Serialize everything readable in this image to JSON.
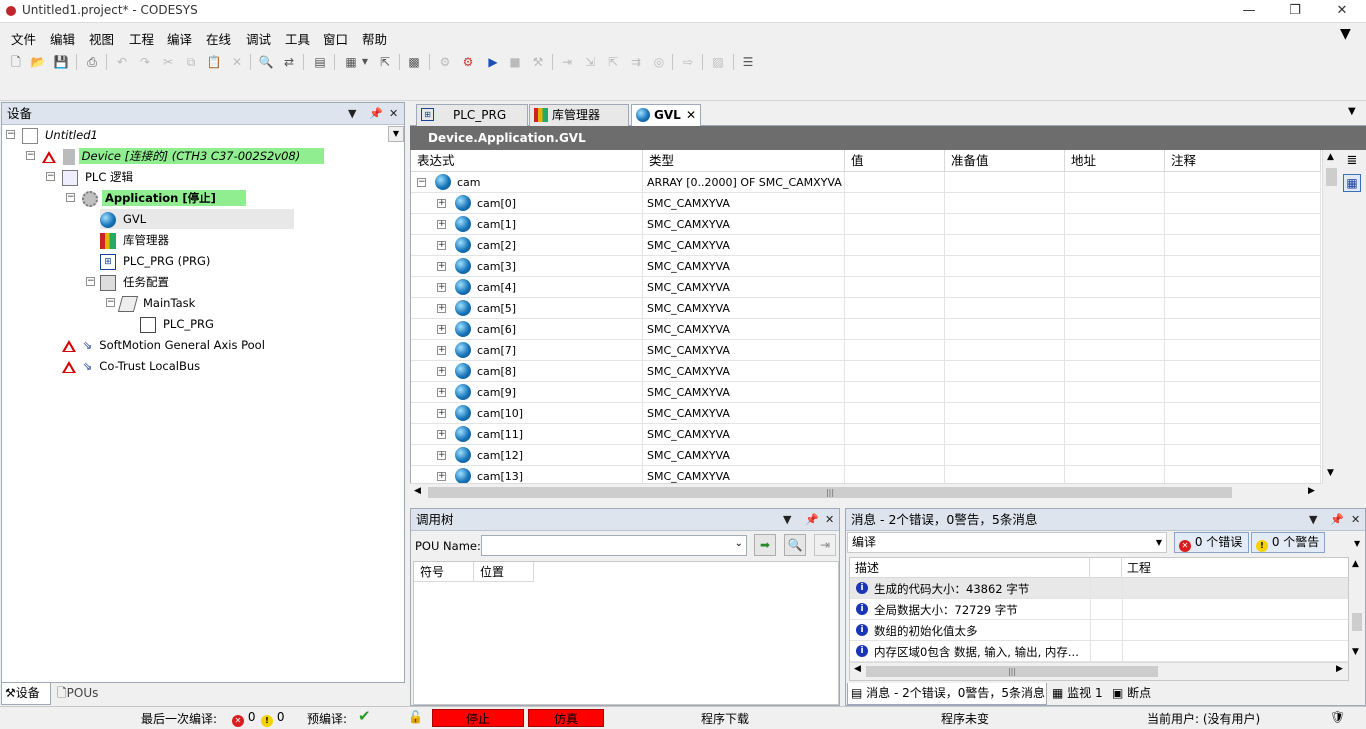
{
  "window": {
    "title": "Untitled1.project* - CODESYS",
    "minimize": "—",
    "restore": "❐",
    "close": "✕"
  },
  "menu": [
    "文件",
    "编辑",
    "视图",
    "工程",
    "编译",
    "在线",
    "调试",
    "工具",
    "窗口",
    "帮助"
  ],
  "device_panel": {
    "title": "设备",
    "tree": {
      "root": "Untitled1",
      "device": "Device [连接的] (CTH3 C37-002S2v08)",
      "plc_logic": "PLC 逻辑",
      "application": "Application [停止]",
      "gvl": "GVL",
      "library_manager": "库管理器",
      "plc_prg": "PLC_PRG (PRG)",
      "task_config": "任务配置",
      "main_task": "MainTask",
      "main_task_prg": "PLC_PRG",
      "softmotion": "SoftMotion General Axis Pool",
      "localbus": "Co-Trust LocalBus"
    },
    "tabs": [
      "设备",
      "POUs"
    ]
  },
  "editor": {
    "tabs": [
      "PLC_PRG",
      "库管理器",
      "GVL"
    ],
    "header": "Device.Application.GVL",
    "columns": [
      "表达式",
      "类型",
      "值",
      "准备值",
      "地址",
      "注释"
    ],
    "rows": [
      {
        "expr": "cam",
        "type": "ARRAY [0..2000] OF SMC_CAMXYVA"
      },
      {
        "expr": "cam[0]",
        "type": "SMC_CAMXYVA"
      },
      {
        "expr": "cam[1]",
        "type": "SMC_CAMXYVA"
      },
      {
        "expr": "cam[2]",
        "type": "SMC_CAMXYVA"
      },
      {
        "expr": "cam[3]",
        "type": "SMC_CAMXYVA"
      },
      {
        "expr": "cam[4]",
        "type": "SMC_CAMXYVA"
      },
      {
        "expr": "cam[5]",
        "type": "SMC_CAMXYVA"
      },
      {
        "expr": "cam[6]",
        "type": "SMC_CAMXYVA"
      },
      {
        "expr": "cam[7]",
        "type": "SMC_CAMXYVA"
      },
      {
        "expr": "cam[8]",
        "type": "SMC_CAMXYVA"
      },
      {
        "expr": "cam[9]",
        "type": "SMC_CAMXYVA"
      },
      {
        "expr": "cam[10]",
        "type": "SMC_CAMXYVA"
      },
      {
        "expr": "cam[11]",
        "type": "SMC_CAMXYVA"
      },
      {
        "expr": "cam[12]",
        "type": "SMC_CAMXYVA"
      },
      {
        "expr": "cam[13]",
        "type": "SMC_CAMXYVA"
      }
    ]
  },
  "call_tree": {
    "title": "调用树",
    "pou_label": "POU Name:",
    "pou_value": "",
    "columns": [
      "符号",
      "位置"
    ]
  },
  "messages": {
    "title": "消息 - 2个错误，0警告，5条消息",
    "category": "编译",
    "errors_btn": "0 个错误",
    "warnings_btn": "0 个警告",
    "columns": [
      "描述",
      "工程"
    ],
    "items": [
      "生成的代码大小：43862 字节",
      "全局数据大小：72729 字节",
      "数组的初始化值太多",
      "内存区域0包含 数据, 输入, 输出, 内存..."
    ],
    "bottom_tabs": [
      "消息 - 2个错误，0警告，5条消息",
      "监视 1",
      "断点"
    ]
  },
  "status": {
    "last_compile_label": "最后一次编译:",
    "errors": "0",
    "warnings": "0",
    "precompile_label": "预编译:",
    "stop": "停止",
    "sim": "仿真",
    "download": "程序下载",
    "unchanged": "程序未变",
    "user": "当前用户: (没有用户)"
  },
  "colors": {
    "panel_head": "#dde4ee",
    "device_highlight": "#90ee90",
    "status_red": "#ff0000",
    "gvl_header": "#6d6d6d"
  }
}
